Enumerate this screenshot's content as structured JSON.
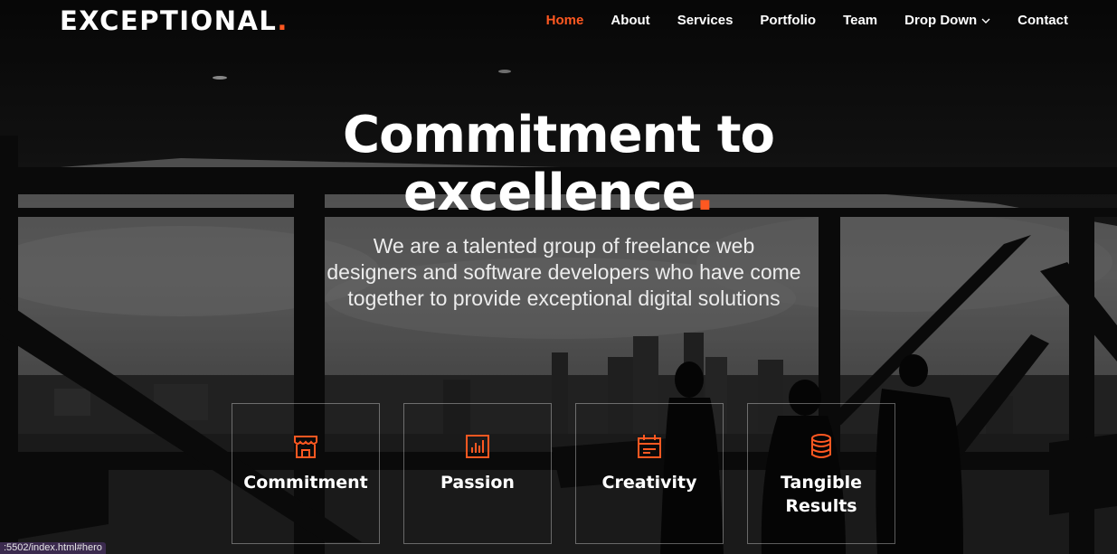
{
  "brand": {
    "name": "EXCEPTIONAL",
    "dot": ".",
    "accent_color": "#ff5821"
  },
  "nav": {
    "items": [
      {
        "label": "Home",
        "active": true
      },
      {
        "label": "About"
      },
      {
        "label": "Services"
      },
      {
        "label": "Portfolio"
      },
      {
        "label": "Team"
      },
      {
        "label": "Drop Down",
        "icon": "chevron-down-icon"
      },
      {
        "label": "Contact"
      }
    ]
  },
  "hero": {
    "title_line1": "Commitment to",
    "title_line2": "excellence",
    "title_dot": ".",
    "subtitle": "We are a talented group of freelance web designers and software developers who have come together to provide exceptional digital solutions"
  },
  "features": [
    {
      "title": "Commitment",
      "icon": "store-icon"
    },
    {
      "title": "Passion",
      "icon": "bar-chart-icon"
    },
    {
      "title": "Creativity",
      "icon": "calendar-icon"
    },
    {
      "title": "Tangible Results",
      "icon": "database-icon"
    }
  ],
  "status_bar": {
    "url": ":5502/index.html#hero"
  }
}
